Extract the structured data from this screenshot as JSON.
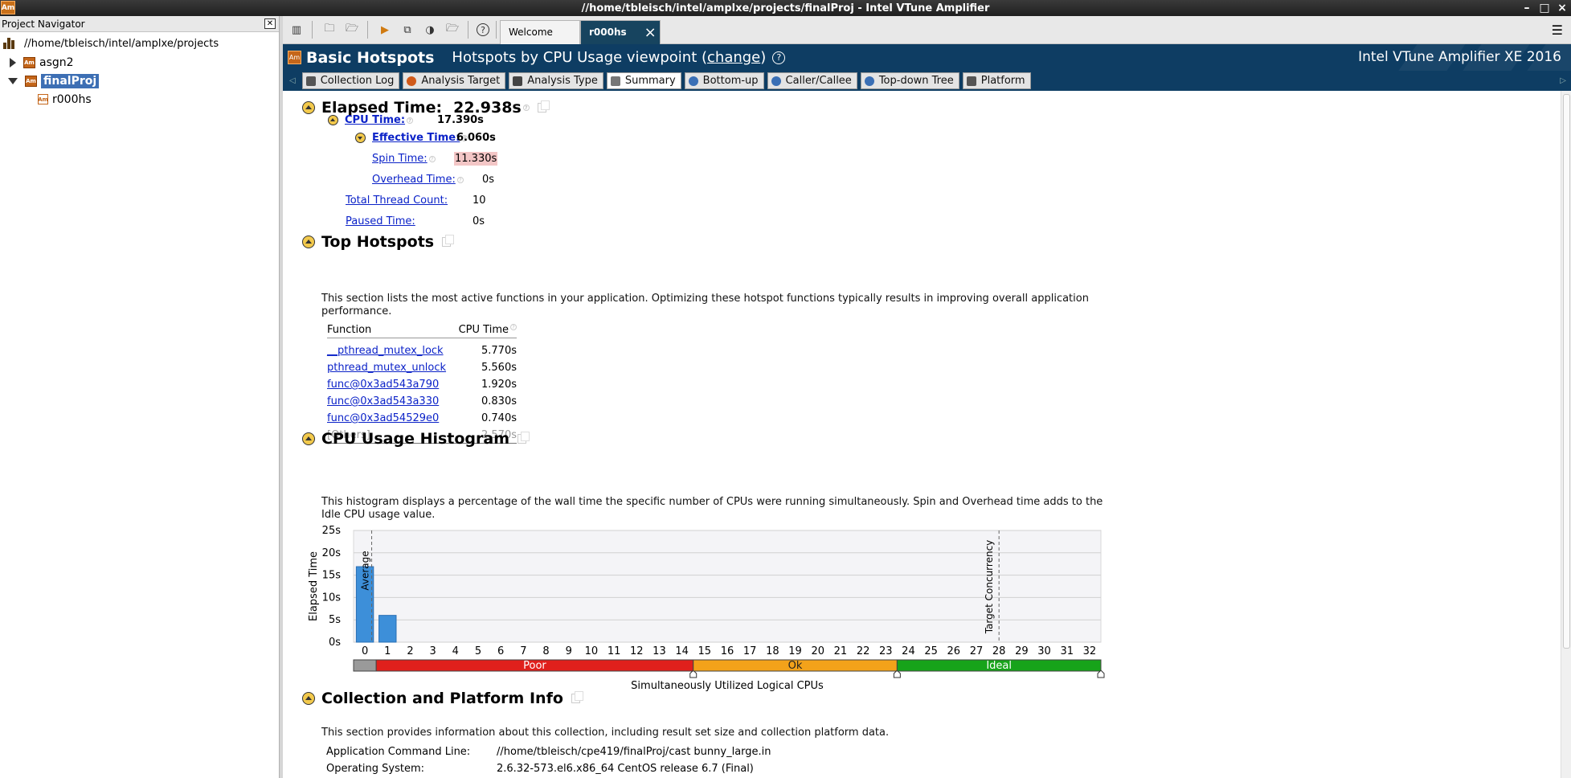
{
  "window": {
    "title": "//home/tbleisch/intel/amplxe/projects/finalProj - Intel VTune Amplifier",
    "icon_text": "Am"
  },
  "navigator": {
    "header": "Project Navigator",
    "root_path": "//home/tbleisch/intel/amplxe/projects",
    "items": [
      {
        "label": "asgn2",
        "expanded": false
      },
      {
        "label": "finalProj",
        "expanded": true,
        "selected": true
      },
      {
        "label": "r000hs",
        "child": true
      }
    ]
  },
  "tabs": [
    {
      "label": "Welcome",
      "active": false
    },
    {
      "label": "r000hs",
      "active": true,
      "close": "×"
    }
  ],
  "header": {
    "title": "Basic Hotspots",
    "viewpoint_prefix": "Hotspots by CPU Usage viewpoint (",
    "change_link": "change",
    "viewpoint_suffix": ")",
    "help": "?",
    "brand": "Intel VTune Amplifier XE 2016"
  },
  "subtabs": [
    {
      "label": "Collection Log",
      "icon_color": "#555555"
    },
    {
      "label": "Analysis Target",
      "icon_color": "#d05a1a"
    },
    {
      "label": "Analysis Type",
      "icon_color": "#444444"
    },
    {
      "label": "Summary",
      "icon_color": "#777777",
      "active": true
    },
    {
      "label": "Bottom-up",
      "icon_color": "#3a6fb5"
    },
    {
      "label": "Caller/Callee",
      "icon_color": "#3a6fb5"
    },
    {
      "label": "Top-down Tree",
      "icon_color": "#3a6fb5"
    },
    {
      "label": "Platform",
      "icon_color": "#555555"
    }
  ],
  "elapsed": {
    "title": "Elapsed Time:",
    "value": "22.938s",
    "cpu_time_label": "CPU Time:",
    "cpu_time_value": "17.390s",
    "effective_label": "Effective Time:",
    "effective_value": "6.060s",
    "spin_label": "Spin Time:",
    "spin_value": "11.330s",
    "overhead_label": "Overhead Time:",
    "overhead_value": "0s",
    "thread_label": "Total Thread Count:",
    "thread_value": "10",
    "paused_label": "Paused Time:",
    "paused_value": "0s"
  },
  "hotspots": {
    "title": "Top Hotspots",
    "description_1": "This section lists the most active functions in your application. Optimizing these hotspot functions typically results in improving overall application",
    "description_2": "performance.",
    "col_function": "Function",
    "col_cpu": "CPU Time",
    "rows": [
      {
        "function": "__pthread_mutex_lock",
        "cpu": "5.770s"
      },
      {
        "function": "pthread_mutex_unlock",
        "cpu": "5.560s"
      },
      {
        "function": "func@0x3ad543a790",
        "cpu": "1.920s"
      },
      {
        "function": "func@0x3ad543a330",
        "cpu": "0.830s"
      },
      {
        "function": "func@0x3ad54529e0",
        "cpu": "0.740s"
      }
    ],
    "others_label": "[Others]",
    "others_cpu": "2.570s"
  },
  "histogram": {
    "title": "CPU Usage Histogram",
    "description_1": "This histogram displays a percentage of the wall time the specific number of CPUs were running simultaneously. Spin and Overhead time adds to the",
    "description_2": "Idle CPU usage value.",
    "average_label": "Average",
    "target_label": "Target Concurrency",
    "band_poor": "Poor",
    "band_ok": "Ok",
    "band_ideal": "Ideal"
  },
  "chart_data": {
    "type": "bar",
    "xlabel": "Simultaneously Utilized Logical CPUs",
    "ylabel": "Elapsed Time",
    "y_ticks": [
      "0s",
      "5s",
      "10s",
      "15s",
      "20s",
      "25s"
    ],
    "ylim": [
      0,
      25
    ],
    "categories": [
      "0",
      "1",
      "2",
      "3",
      "4",
      "5",
      "6",
      "7",
      "8",
      "9",
      "10",
      "11",
      "12",
      "13",
      "14",
      "15",
      "16",
      "17",
      "18",
      "19",
      "20",
      "21",
      "22",
      "23",
      "24",
      "25",
      "26",
      "27",
      "28",
      "29",
      "30",
      "31",
      "32"
    ],
    "values": [
      16.9,
      6.0,
      0,
      0,
      0,
      0,
      0,
      0,
      0,
      0,
      0,
      0,
      0,
      0,
      0,
      0,
      0,
      0,
      0,
      0,
      0,
      0,
      0,
      0,
      0,
      0,
      0,
      0,
      0,
      0,
      0,
      0,
      0
    ],
    "average_marker": 0.3,
    "target_marker": 28,
    "bands": [
      {
        "label": "",
        "from": -0.5,
        "to": 0.5,
        "color": "#9a9a9a"
      },
      {
        "label": "Poor",
        "from": 0.5,
        "to": 14.5,
        "color": "#e0201c"
      },
      {
        "label": "Ok",
        "from": 14.5,
        "to": 23.5,
        "color": "#f3a21a"
      },
      {
        "label": "Ideal",
        "from": 23.5,
        "to": 32.5,
        "color": "#17a31a"
      }
    ],
    "bar_color": "#3d8fd9",
    "grid": true
  },
  "platform": {
    "title": "Collection and Platform Info",
    "description": "This section provides information about this collection, including result set size and collection platform data.",
    "rows": [
      {
        "label": "Application Command Line:",
        "value": "//home/tbleisch/cpe419/finalProj/cast bunny_large.in"
      },
      {
        "label": "Operating System:",
        "value": "2.6.32-573.el6.x86_64 CentOS release 6.7 (Final)"
      }
    ]
  }
}
